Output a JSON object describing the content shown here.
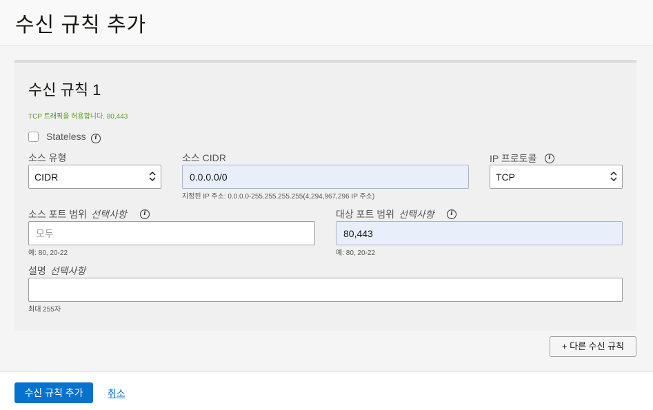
{
  "header": {
    "title": "수신 규칙 추가"
  },
  "rule": {
    "title": "수신 규칙 1",
    "summary": "TCP 트래픽을 허용합니다. 80,443",
    "stateless_label": "Stateless",
    "source_type": {
      "label": "소스 유형",
      "value": "CIDR"
    },
    "source_cidr": {
      "label": "소스 CIDR",
      "value": "0.0.0.0/0",
      "hint": "지정된 IP 주소: 0.0.0.0-255.255.255.255(4,294,967,296 IP 주소)"
    },
    "ip_protocol": {
      "label": "IP 프로토콜",
      "value": "TCP"
    },
    "source_port": {
      "label": "소스 포트 범위",
      "optional": "선택사항",
      "placeholder": "모두",
      "value": "",
      "hint": "예: 80, 20-22"
    },
    "dest_port": {
      "label": "대상 포트 범위",
      "optional": "선택사항",
      "value": "80,443",
      "hint": "예: 80, 20-22"
    },
    "description": {
      "label": "설명",
      "optional": "선택사항",
      "value": "",
      "hint": "최대 255자"
    }
  },
  "another_rule_button": "+ 다른 수신 규칙",
  "footer": {
    "submit_label": "수신 규칙 추가",
    "cancel_label": "취소"
  },
  "colors": {
    "primary": "#0572ce",
    "success_text": "#5a9f1e",
    "filled_input": "#e8effa"
  }
}
